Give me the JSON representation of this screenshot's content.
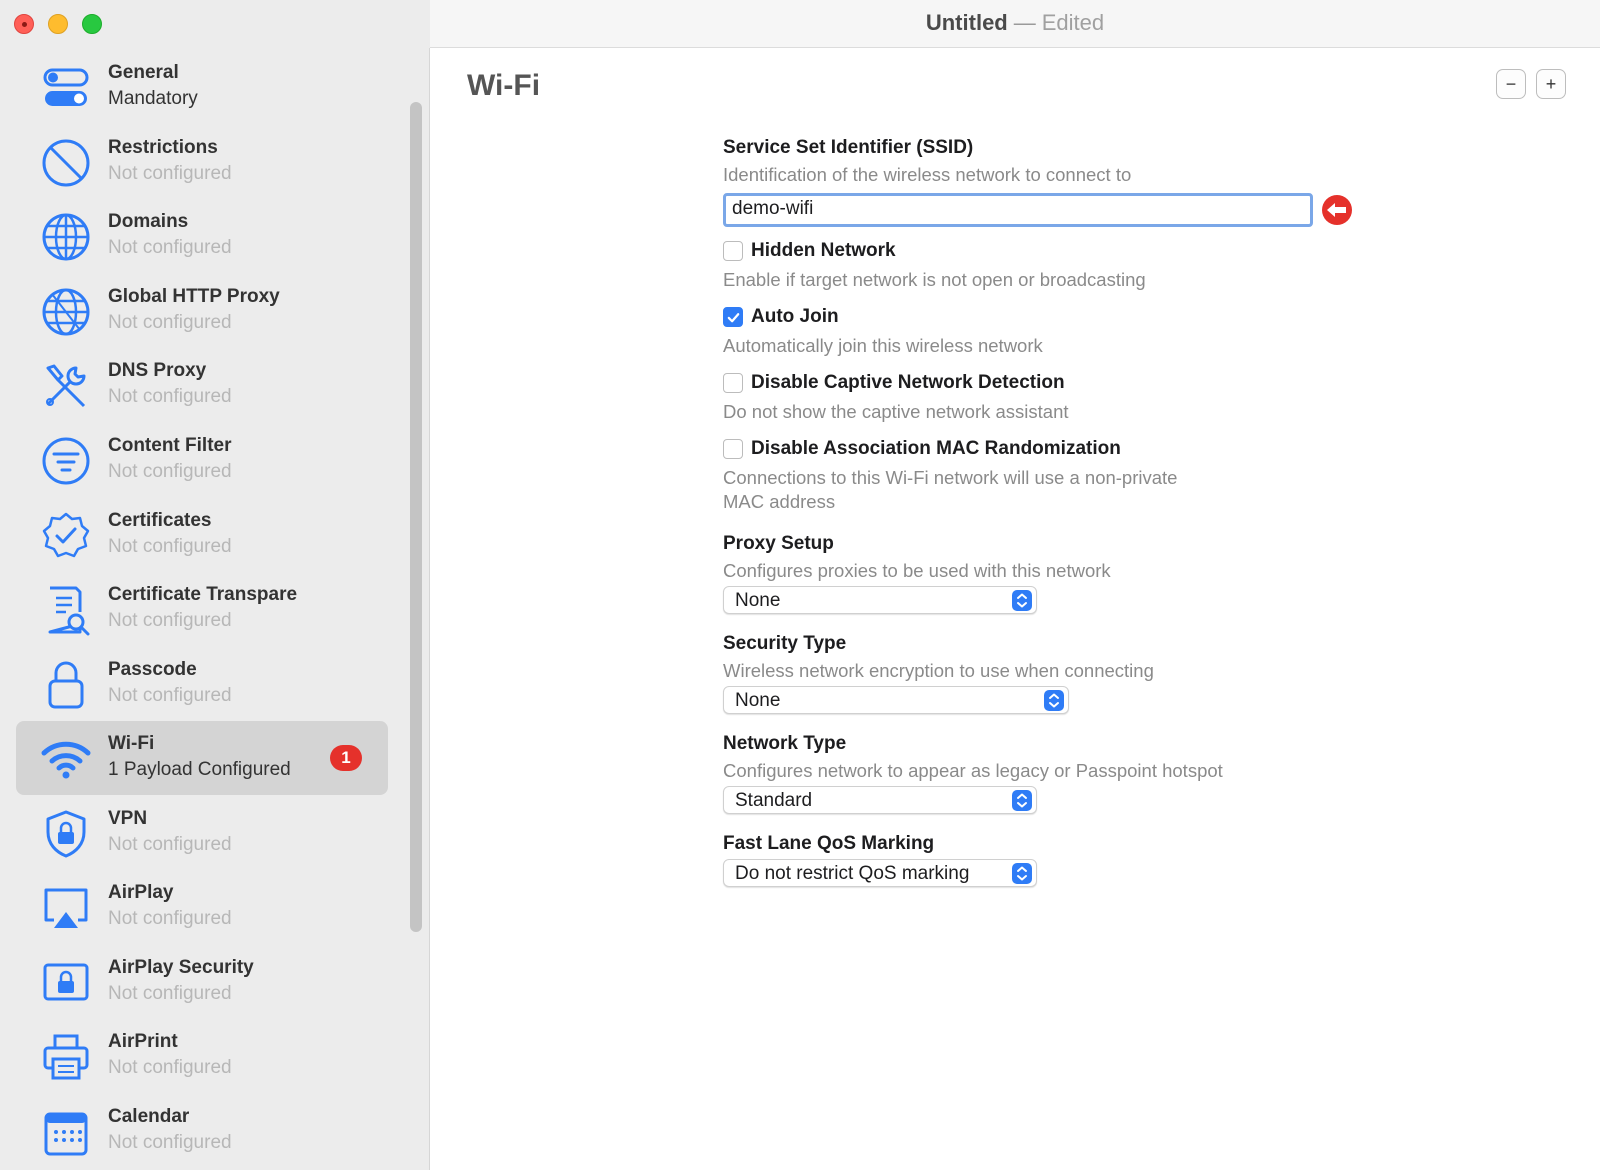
{
  "window": {
    "title": "Untitled",
    "separator": "—",
    "status": "Edited"
  },
  "sidebar": {
    "items": [
      {
        "title": "General",
        "subtitle": "Mandatory",
        "icon": "toggle-icon"
      },
      {
        "title": "Restrictions",
        "subtitle": "Not configured",
        "icon": "prohibited-icon"
      },
      {
        "title": "Domains",
        "subtitle": "Not configured",
        "icon": "globe-icon"
      },
      {
        "title": "Global HTTP Proxy",
        "subtitle": "Not configured",
        "icon": "globe-network-icon"
      },
      {
        "title": "DNS Proxy",
        "subtitle": "Not configured",
        "icon": "tools-icon"
      },
      {
        "title": "Content Filter",
        "subtitle": "Not configured",
        "icon": "filter-icon"
      },
      {
        "title": "Certificates",
        "subtitle": "Not configured",
        "icon": "certificate-badge-icon"
      },
      {
        "title": "Certificate Transpare",
        "subtitle": "Not configured",
        "icon": "document-search-icon"
      },
      {
        "title": "Passcode",
        "subtitle": "Not configured",
        "icon": "lock-icon"
      },
      {
        "title": "Wi-Fi",
        "subtitle": "1 Payload Configured",
        "icon": "wifi-icon",
        "badge": "1"
      },
      {
        "title": "VPN",
        "subtitle": "Not configured",
        "icon": "shield-lock-icon"
      },
      {
        "title": "AirPlay",
        "subtitle": "Not configured",
        "icon": "airplay-icon"
      },
      {
        "title": "AirPlay Security",
        "subtitle": "Not configured",
        "icon": "airplay-lock-icon"
      },
      {
        "title": "AirPrint",
        "subtitle": "Not configured",
        "icon": "printer-icon"
      },
      {
        "title": "Calendar",
        "subtitle": "Not configured",
        "icon": "calendar-icon"
      }
    ]
  },
  "main": {
    "title": "Wi-Fi",
    "remove_button": "−",
    "add_button": "+",
    "ssid": {
      "label": "Service Set Identifier (SSID)",
      "description": "Identification of the wireless network to connect to",
      "value": "demo-wifi"
    },
    "hidden_network": {
      "label": "Hidden Network",
      "description": "Enable if target network is not open or broadcasting",
      "checked": false
    },
    "auto_join": {
      "label": "Auto Join",
      "description": "Automatically join this wireless network",
      "checked": true
    },
    "captive": {
      "label": "Disable Captive Network Detection",
      "description": "Do not show the captive network assistant",
      "checked": false
    },
    "mac_random": {
      "label": "Disable Association MAC Randomization",
      "description_line1": "Connections to this Wi-Fi network will use a non-private",
      "description_line2": "MAC address",
      "checked": false
    },
    "proxy": {
      "label": "Proxy Setup",
      "description": "Configures proxies to be used with this network",
      "value": "None"
    },
    "security": {
      "label": "Security Type",
      "description": "Wireless network encryption to use when connecting",
      "value": "None"
    },
    "network_type": {
      "label": "Network Type",
      "description": "Configures network to appear as legacy or Passpoint hotspot",
      "value": "Standard"
    },
    "qos": {
      "label": "Fast Lane QoS Marking",
      "value": "Do not restrict QoS marking"
    }
  },
  "colors": {
    "accent": "#2f7cf6",
    "badge": "#e5312b",
    "error": "#e5312b"
  }
}
